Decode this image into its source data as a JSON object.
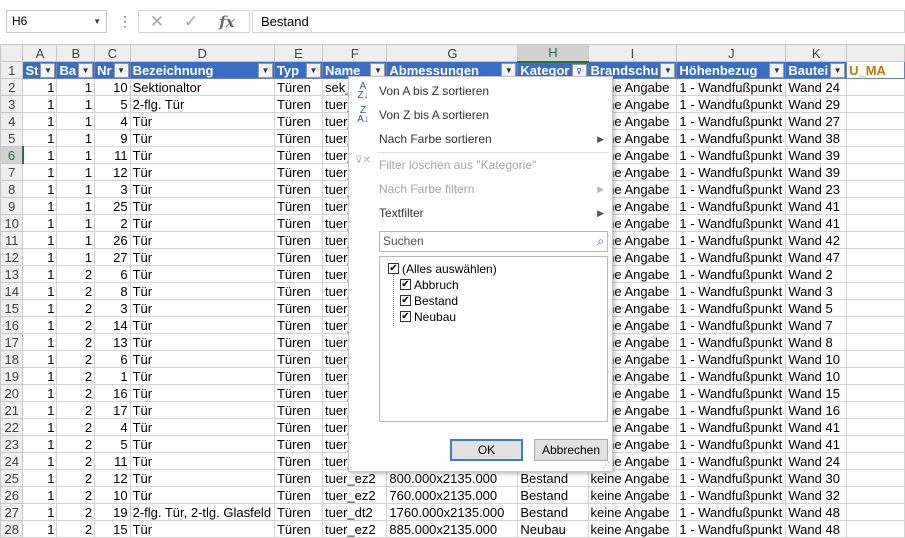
{
  "formula_bar": {
    "name_box": "H6",
    "formula": "Bestand",
    "dots": "⋮",
    "cancel_glyph": "✕",
    "enter_glyph": "✓",
    "fx_glyph": "fx"
  },
  "columns": [
    "A",
    "B",
    "C",
    "D",
    "E",
    "F",
    "G",
    "H",
    "I",
    "J",
    "K"
  ],
  "selected_column": "H",
  "header_row": {
    "row_number": "1",
    "cells": [
      "St",
      "Ba",
      "Nr",
      "Bezeichnung",
      "Typ",
      "Name",
      "Abmessungen",
      "Kategor",
      "Brandschu",
      "Höhenbezug",
      "Bautei",
      "U_MA"
    ]
  },
  "rows": [
    {
      "n": "2",
      "c": [
        "1",
        "1",
        "10",
        "Sektionaltor",
        "Türen",
        "sek_",
        "",
        "",
        "keine Angabe",
        "1 - Wandfußpunkt",
        "Wand 24"
      ]
    },
    {
      "n": "3",
      "c": [
        "1",
        "1",
        "5",
        "2-flg. Tür",
        "Türen",
        "tuer_",
        "",
        "",
        "keine Angabe",
        "1 - Wandfußpunkt",
        "Wand 29"
      ]
    },
    {
      "n": "4",
      "c": [
        "1",
        "1",
        "4",
        "Tür",
        "Türen",
        "tuer_",
        "",
        "",
        "keine Angabe",
        "1 - Wandfußpunkt",
        "Wand 27"
      ]
    },
    {
      "n": "5",
      "c": [
        "1",
        "1",
        "9",
        "Tür",
        "Türen",
        "tuer_",
        "",
        "",
        "keine Angabe",
        "1 - Wandfußpunkt",
        "Wand 38"
      ]
    },
    {
      "n": "6",
      "c": [
        "1",
        "1",
        "11",
        "Tür",
        "Türen",
        "tuer_",
        "",
        "",
        "keine Angabe",
        "1 - Wandfußpunkt",
        "Wand 39"
      ]
    },
    {
      "n": "7",
      "c": [
        "1",
        "1",
        "12",
        "Tür",
        "Türen",
        "tuer_",
        "",
        "",
        "keine Angabe",
        "1 - Wandfußpunkt",
        "Wand 39"
      ]
    },
    {
      "n": "8",
      "c": [
        "1",
        "1",
        "3",
        "Tür",
        "Türen",
        "tuer_",
        "",
        "",
        "keine Angabe",
        "1 - Wandfußpunkt",
        "Wand 23"
      ]
    },
    {
      "n": "9",
      "c": [
        "1",
        "1",
        "25",
        "Tür",
        "Türen",
        "tuer_",
        "",
        "",
        "keine Angabe",
        "1 - Wandfußpunkt",
        "Wand 41"
      ]
    },
    {
      "n": "10",
      "c": [
        "1",
        "1",
        "2",
        "Tür",
        "Türen",
        "tuer_",
        "",
        "",
        "keine Angabe",
        "1 - Wandfußpunkt",
        "Wand 41"
      ]
    },
    {
      "n": "11",
      "c": [
        "1",
        "1",
        "26",
        "Tür",
        "Türen",
        "tuer_",
        "",
        "",
        "keine Angabe",
        "1 - Wandfußpunkt",
        "Wand 42"
      ]
    },
    {
      "n": "12",
      "c": [
        "1",
        "1",
        "27",
        "Tür",
        "Türen",
        "tuer_",
        "",
        "",
        "keine Angabe",
        "1 - Wandfußpunkt",
        "Wand 47"
      ]
    },
    {
      "n": "13",
      "c": [
        "1",
        "2",
        "6",
        "Tür",
        "Türen",
        "tuer_",
        "",
        "",
        "keine Angabe",
        "1 - Wandfußpunkt",
        "Wand 2"
      ]
    },
    {
      "n": "14",
      "c": [
        "1",
        "2",
        "8",
        "Tür",
        "Türen",
        "tuer_",
        "",
        "",
        "keine Angabe",
        "1 - Wandfußpunkt",
        "Wand 3"
      ]
    },
    {
      "n": "15",
      "c": [
        "1",
        "2",
        "3",
        "Tür",
        "Türen",
        "tuer_",
        "",
        "",
        "keine Angabe",
        "1 - Wandfußpunkt",
        "Wand 5"
      ]
    },
    {
      "n": "16",
      "c": [
        "1",
        "2",
        "14",
        "Tür",
        "Türen",
        "tuer_",
        "",
        "",
        "keine Angabe",
        "1 - Wandfußpunkt",
        "Wand 7"
      ]
    },
    {
      "n": "17",
      "c": [
        "1",
        "2",
        "13",
        "Tür",
        "Türen",
        "tuer_",
        "",
        "",
        "keine Angabe",
        "1 - Wandfußpunkt",
        "Wand 8"
      ]
    },
    {
      "n": "18",
      "c": [
        "1",
        "2",
        "6",
        "Tür",
        "Türen",
        "tuer_",
        "",
        "",
        "keine Angabe",
        "1 - Wandfußpunkt",
        "Wand 10"
      ]
    },
    {
      "n": "19",
      "c": [
        "1",
        "2",
        "1",
        "Tür",
        "Türen",
        "tuer_",
        "",
        "",
        "keine Angabe",
        "1 - Wandfußpunkt",
        "Wand 10"
      ]
    },
    {
      "n": "20",
      "c": [
        "1",
        "2",
        "16",
        "Tür",
        "Türen",
        "tuer_",
        "",
        "",
        "keine Angabe",
        "1 - Wandfußpunkt",
        "Wand 15"
      ]
    },
    {
      "n": "21",
      "c": [
        "1",
        "2",
        "17",
        "Tür",
        "Türen",
        "tuer_",
        "",
        "",
        "keine Angabe",
        "1 - Wandfußpunkt",
        "Wand 16"
      ]
    },
    {
      "n": "22",
      "c": [
        "1",
        "2",
        "4",
        "Tür",
        "Türen",
        "tuer_",
        "",
        "",
        "keine Angabe",
        "1 - Wandfußpunkt",
        "Wand 41"
      ]
    },
    {
      "n": "23",
      "c": [
        "1",
        "2",
        "5",
        "Tür",
        "Türen",
        "tuer_",
        "",
        "",
        "keine Angabe",
        "1 - Wandfußpunkt",
        "Wand 41"
      ]
    },
    {
      "n": "24",
      "c": [
        "1",
        "2",
        "11",
        "Tür",
        "Türen",
        "tuer_",
        "",
        "",
        "keine Angabe",
        "1 - Wandfußpunkt",
        "Wand 24"
      ]
    },
    {
      "n": "25",
      "c": [
        "1",
        "2",
        "12",
        "Tür",
        "Türen",
        "tuer_ez2",
        "800.000x2135.000",
        "Bestand",
        "keine Angabe",
        "1 - Wandfußpunkt",
        "Wand 30"
      ]
    },
    {
      "n": "26",
      "c": [
        "1",
        "2",
        "10",
        "Tür",
        "Türen",
        "tuer_ez2",
        "760.000x2135.000",
        "Bestand",
        "keine Angabe",
        "1 - Wandfußpunkt",
        "Wand 32"
      ]
    },
    {
      "n": "27",
      "c": [
        "1",
        "2",
        "19",
        "2-flg. Tür, 2-tlg. Glasfeld",
        "Türen",
        "tuer_dt2",
        "1760.000x2135.000",
        "Bestand",
        "keine Angabe",
        "1 - Wandfußpunkt",
        "Wand 48"
      ]
    },
    {
      "n": "28",
      "c": [
        "1",
        "2",
        "15",
        "Tür",
        "Türen",
        "tuer_ez2",
        "885.000x2135.000",
        "Neubau",
        "keine Angabe",
        "1 - Wandfußpunkt",
        "Wand 48"
      ]
    }
  ],
  "menu": {
    "sort_az": "Von A bis Z sortieren",
    "sort_za": "Von Z bis A sortieren",
    "sort_color": "Nach Farbe sortieren",
    "clear_filter": "Filter löschen aus \"Kategorie\"",
    "filter_color": "Nach Farbe filtern",
    "text_filter": "Textfilter",
    "search_placeholder": "Suchen",
    "items": [
      {
        "label": "(Alles auswählen)",
        "checked": true
      },
      {
        "label": "Abbruch",
        "checked": true
      },
      {
        "label": "Bestand",
        "checked": true
      },
      {
        "label": "Neubau",
        "checked": true
      }
    ],
    "ok": "OK",
    "cancel": "Abbrechen"
  },
  "colors": {
    "header_blue": "#3a6ec5",
    "excel_green": "#217346",
    "gold_text": "#c07a00"
  }
}
